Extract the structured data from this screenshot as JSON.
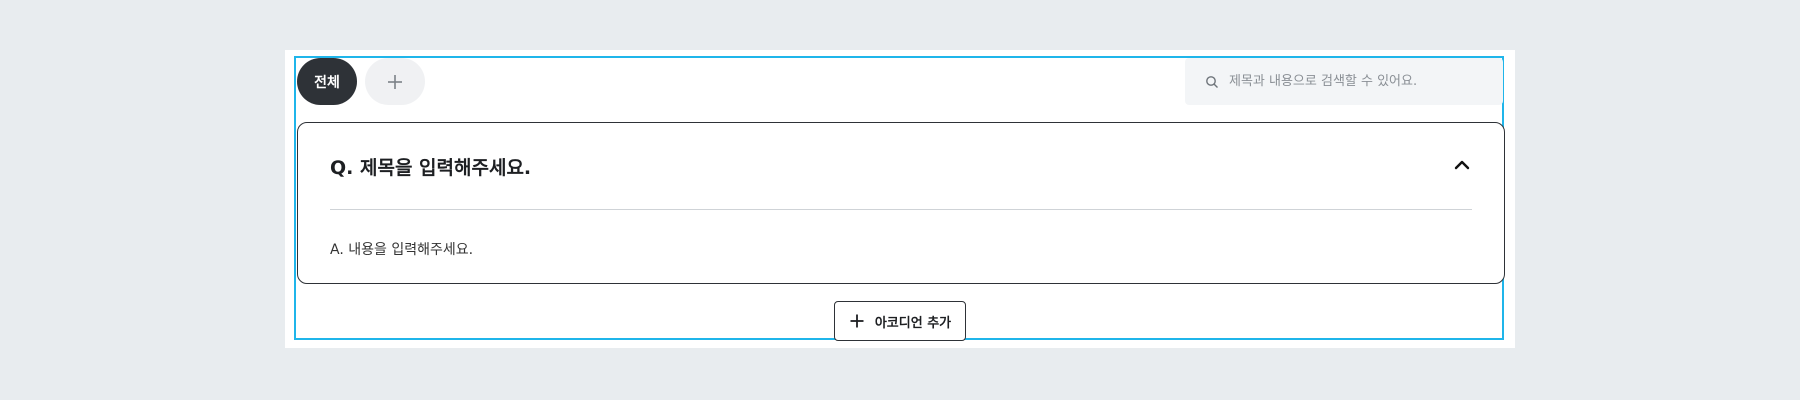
{
  "tabs": {
    "all_label": "전체",
    "add_icon": "plus-icon"
  },
  "search": {
    "icon": "search-icon",
    "placeholder": "제목과 내용으로 검색할 수 있어요.",
    "value": ""
  },
  "accordion": {
    "title": "Q. 제목을 입력해주세요.",
    "body": "A. 내용을 입력해주세요.",
    "toggle_icon": "chevron-up-icon",
    "expanded": true
  },
  "add_accordion": {
    "icon": "plus-icon",
    "label": "아코디언 추가"
  },
  "colors": {
    "page_bg": "#e8ecef",
    "selection_border": "#1fb5ea",
    "dark": "#2e3237",
    "search_bg": "#f3f5f7"
  }
}
